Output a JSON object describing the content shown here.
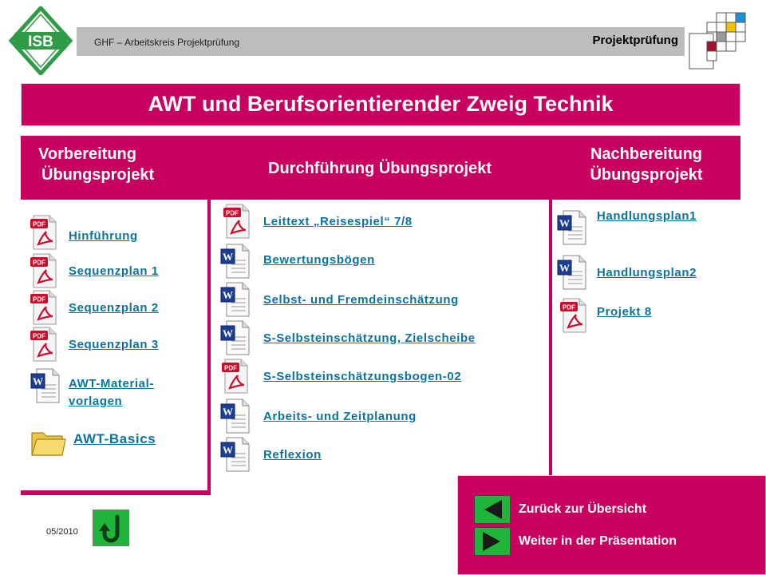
{
  "header": {
    "logo_text": "ISB",
    "left_text": "GHF – Arbeitskreis Projektprüfung",
    "right_text": "Projektprüfung"
  },
  "title": "AWT und Berufsorientierender Zweig Technik",
  "columns": [
    {
      "heading": [
        "Vorbereitung",
        "Übungsprojekt"
      ],
      "items": [
        {
          "label": "Hinführung",
          "icon": "pdf-icon"
        },
        {
          "label": "Sequenzplan 1",
          "icon": "pdf-icon"
        },
        {
          "label": "Sequenzplan 2",
          "icon": "pdf-icon"
        },
        {
          "label": "Sequenzplan 3",
          "icon": "pdf-icon"
        },
        {
          "label_lines": [
            "AWT-Material-",
            "vorlagen"
          ],
          "icon": "word-icon"
        },
        {
          "label": "AWT-Basics",
          "icon": "folder-icon"
        }
      ]
    },
    {
      "heading": [
        "Durchführung Übungsprojekt"
      ],
      "items": [
        {
          "label": "Leittext „Reisespiel“ 7/8",
          "icon": "pdf-icon"
        },
        {
          "label": "Bewertungsbögen",
          "icon": "word-icon"
        },
        {
          "label": "Selbst- und Fremdeinschätzung",
          "icon": "word-icon"
        },
        {
          "label": "S-Selbsteinschätzung, Zielscheibe",
          "icon": "word-icon"
        },
        {
          "label": "S-Selbsteinschätzungsbogen-02",
          "icon": "pdf-icon"
        },
        {
          "label": "Arbeits- und Zeitplanung",
          "icon": "word-icon"
        },
        {
          "label": "Reflexion",
          "icon": "word-icon"
        }
      ]
    },
    {
      "heading": [
        "Nachbereitung",
        "Übungsprojekt"
      ],
      "items": [
        {
          "label": "Handlungsplan1",
          "icon": "word-icon"
        },
        {
          "label": "Handlungsplan2",
          "icon": "word-icon"
        },
        {
          "label": "Projekt 8",
          "icon": "pdf-icon"
        }
      ]
    }
  ],
  "footer": {
    "date": "05/2010",
    "back_label": "Zurück zur Übersicht",
    "next_label": "Weiter in der Präsentation"
  },
  "colors": {
    "accent": "#c8005f",
    "link": "#0a73a0",
    "button_green": "#1fb53a"
  }
}
